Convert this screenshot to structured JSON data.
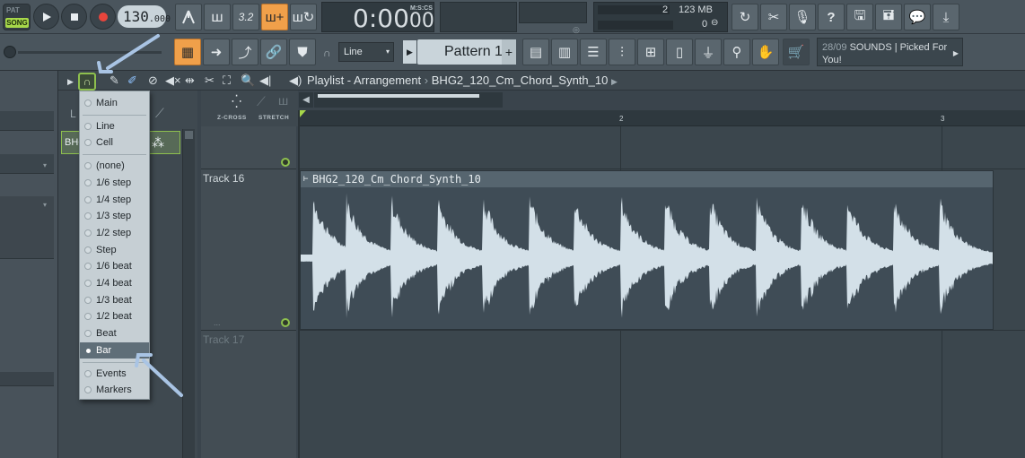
{
  "transport": {
    "pat_label": "PAT",
    "song_label": "SONG",
    "tempo_main": "130",
    "tempo_frac": ".000",
    "time": "0:00",
    "time_frac": "00",
    "time_unit": "M:S:CS"
  },
  "cpu": {
    "voices": "2",
    "memory": "123 MB",
    "polyphony": "0"
  },
  "toolbar": {
    "snap_mode": "Line",
    "pattern_name": "Pattern 1",
    "pattern_add": "+"
  },
  "hint_bar": {
    "date": "28/09",
    "message": "SOUNDS | Picked For You!"
  },
  "playlist": {
    "title": "Playlist - Arrangement",
    "separator": "›",
    "clip_name": "BHG2_120_Cm_Chord_Synth_10",
    "zcross_label": "Z-CROSS",
    "stretch_label": "STRETCH",
    "ruler": [
      "2",
      "3"
    ],
    "tracks": [
      {
        "name": "Track 16",
        "dots": "..."
      },
      {
        "name": "Track 17"
      }
    ]
  },
  "channel": {
    "item_label": "BHG"
  },
  "snap_menu": {
    "items": [
      {
        "label": "Main",
        "selected": false,
        "group": 1
      },
      {
        "label": "Line",
        "selected": false,
        "group": 2
      },
      {
        "label": "Cell",
        "selected": false,
        "group": 2
      },
      {
        "label": "(none)",
        "selected": false,
        "group": 3
      },
      {
        "label": "1/6 step",
        "selected": false,
        "group": 3
      },
      {
        "label": "1/4 step",
        "selected": false,
        "group": 3
      },
      {
        "label": "1/3 step",
        "selected": false,
        "group": 3
      },
      {
        "label": "1/2 step",
        "selected": false,
        "group": 3
      },
      {
        "label": "Step",
        "selected": false,
        "group": 3
      },
      {
        "label": "1/6 beat",
        "selected": false,
        "group": 3
      },
      {
        "label": "1/4 beat",
        "selected": false,
        "group": 3
      },
      {
        "label": "1/3 beat",
        "selected": false,
        "group": 3
      },
      {
        "label": "1/2 beat",
        "selected": false,
        "group": 3
      },
      {
        "label": "Beat",
        "selected": false,
        "group": 3
      },
      {
        "label": "Bar",
        "selected": true,
        "group": 3
      },
      {
        "label": "Events",
        "selected": false,
        "group": 4
      },
      {
        "label": "Markers",
        "selected": false,
        "group": 4
      }
    ]
  },
  "colors": {
    "accent_orange": "#f0a04a",
    "accent_green": "#8ec04e",
    "waveform": "#d3e0e8",
    "annotation_arrow": "#a9c4e4"
  },
  "waveform": {
    "hits": [
      0.27,
      1.0,
      1.98,
      3.0,
      4.0,
      5.02,
      6.0,
      7.02,
      8.0,
      8.98,
      10.0,
      11.0,
      12.0,
      13.02,
      14.02
    ]
  }
}
